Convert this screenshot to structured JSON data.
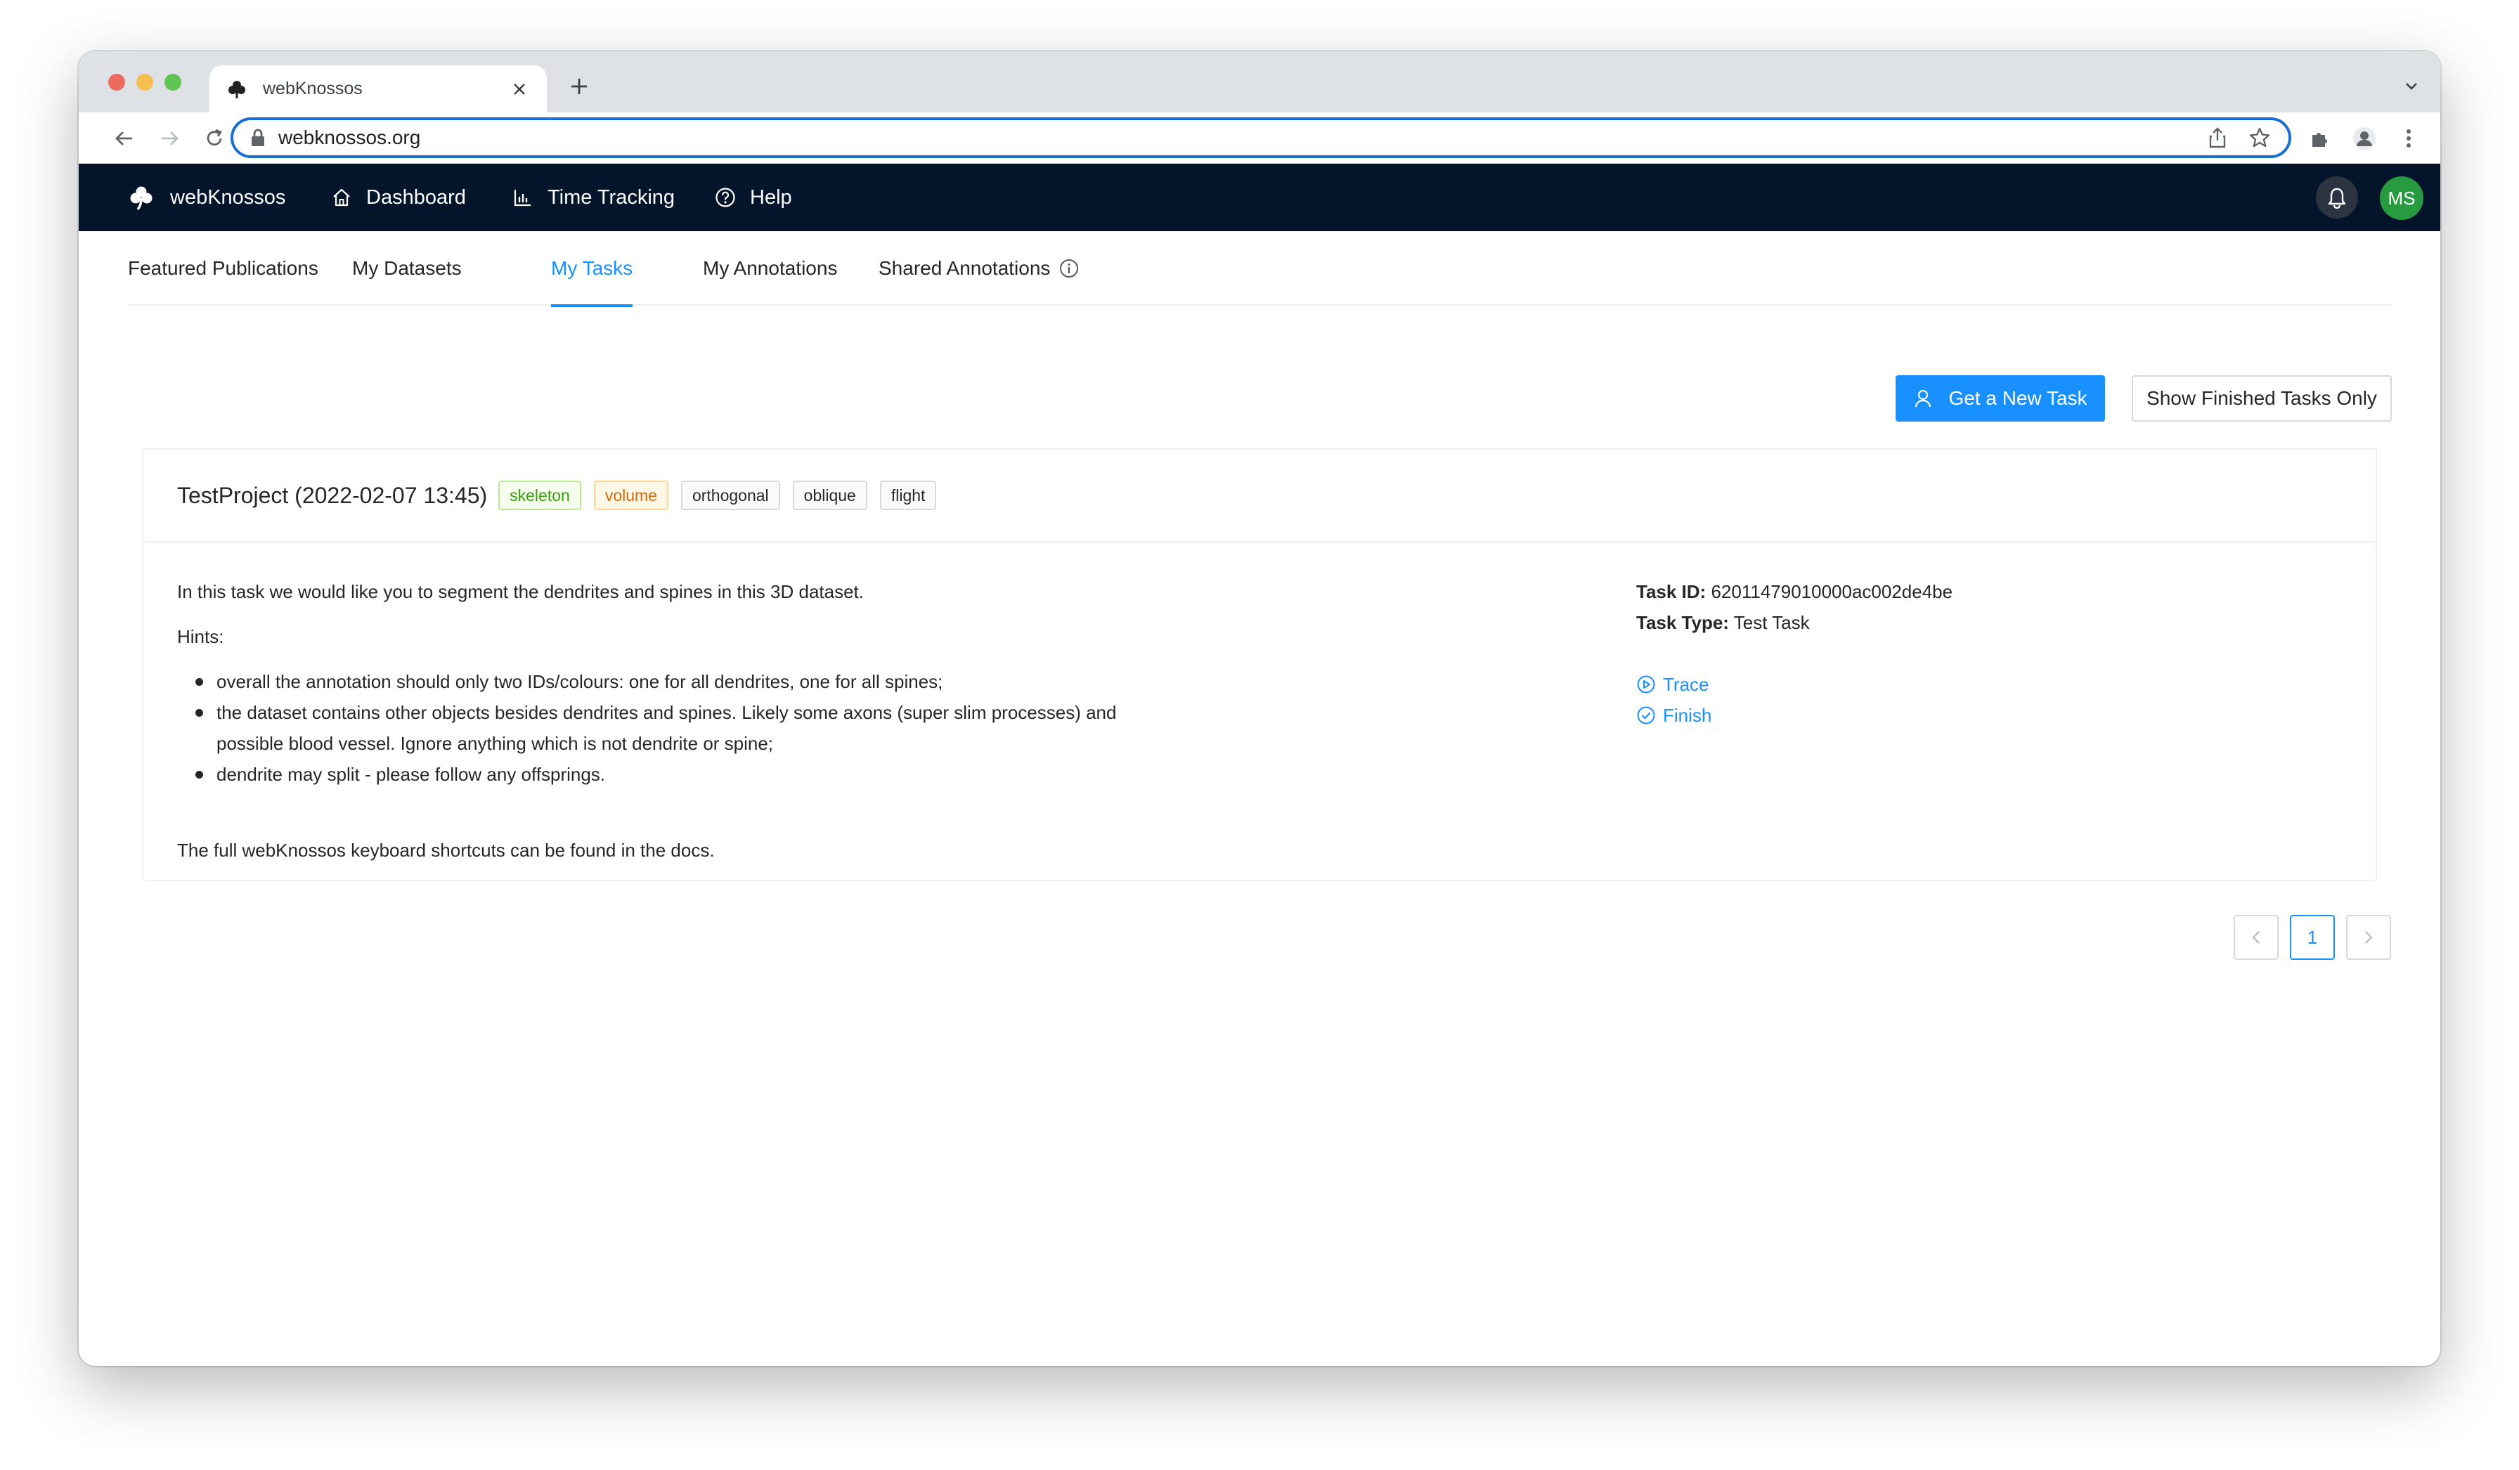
{
  "browser": {
    "tab_title": "webKnossos",
    "url": "webknossos.org"
  },
  "header": {
    "logo_text": "webKnossos",
    "nav": [
      {
        "label": "Dashboard",
        "icon": "home-icon"
      },
      {
        "label": "Time Tracking",
        "icon": "bar-chart-icon"
      },
      {
        "label": "Help",
        "icon": "question-circle-icon"
      }
    ],
    "user_initials": "MS"
  },
  "tabs": [
    {
      "label": "Featured Publications",
      "active": false
    },
    {
      "label": "My Datasets",
      "active": false
    },
    {
      "label": "My Tasks",
      "active": true
    },
    {
      "label": "My Annotations",
      "active": false
    },
    {
      "label": "Shared Annotations",
      "active": false
    }
  ],
  "actions": {
    "new_task": "Get a New Task",
    "show_finished": "Show Finished Tasks Only"
  },
  "task": {
    "title": "TestProject (2022-02-07 13:45)",
    "tags": [
      "skeleton",
      "volume",
      "orthogonal",
      "oblique",
      "flight"
    ],
    "intro": "In this task we would like you to segment the dendrites and spines in this 3D dataset.",
    "hints_label": "Hints:",
    "hints": [
      "overall the annotation should only two IDs/colours: one for all dendrites, one for all spines;",
      "the dataset contains other objects besides dendrites and spines. Likely some axons (super slim processes) and possible blood vessel. Ignore anything which is not dendrite or spine;",
      "dendrite may split - please follow any offsprings."
    ],
    "footer": "The full webKnossos keyboard shortcuts can be found in the docs.",
    "id_label": "Task ID:",
    "id_value": "62011479010000ac002de4be",
    "type_label": "Task Type:",
    "type_value": "Test Task",
    "trace_label": "Trace",
    "finish_label": "Finish"
  },
  "pagination": {
    "current_page": "1"
  },
  "colors": {
    "header_bg": "#04152b",
    "accent": "#1890ff",
    "avatar": "#289b40"
  }
}
